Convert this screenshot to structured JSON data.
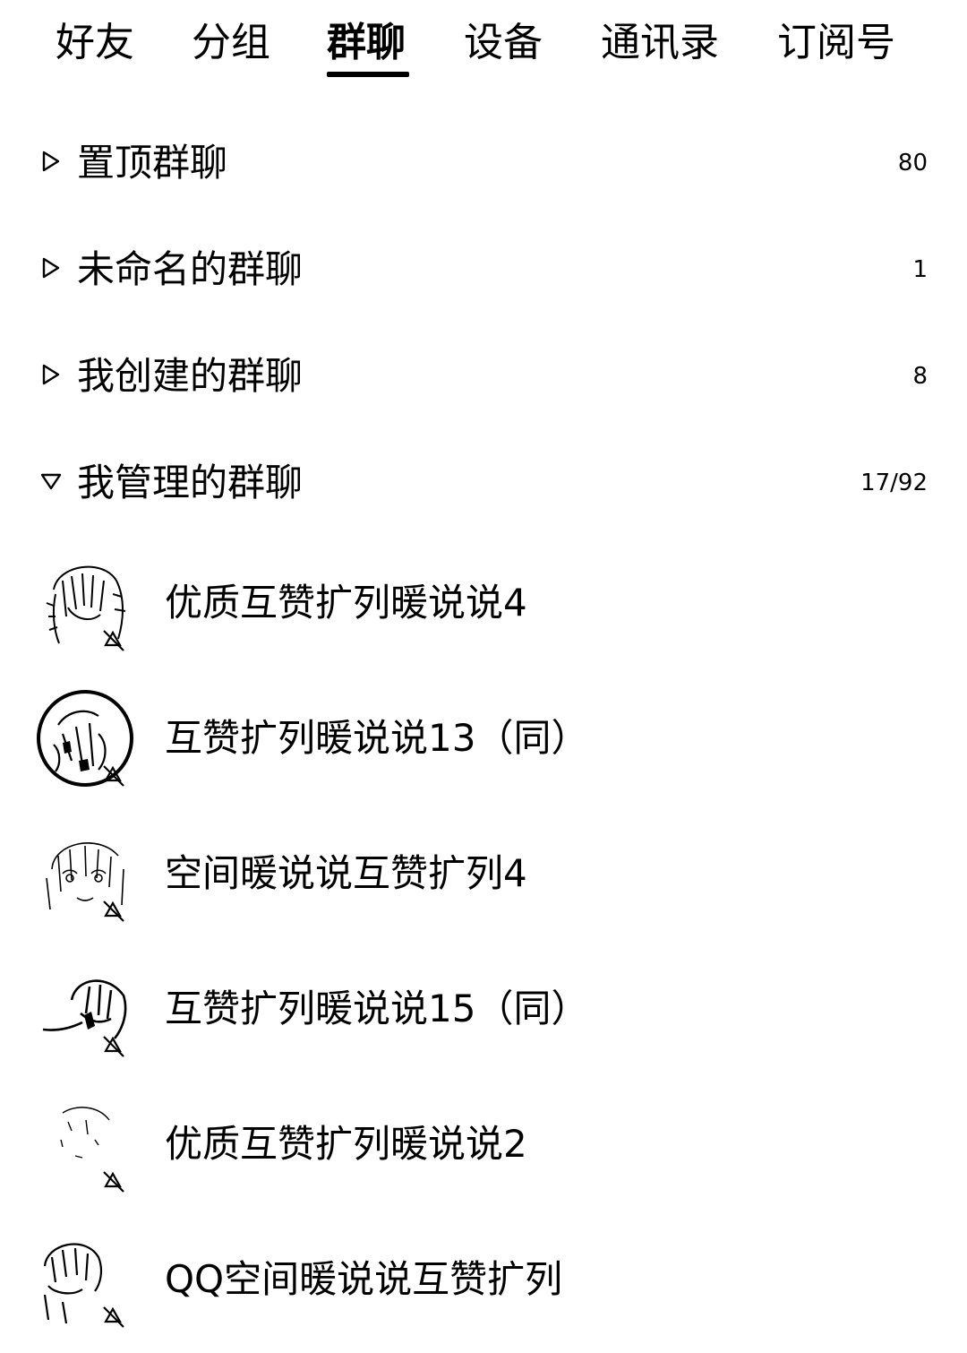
{
  "tabs": [
    {
      "label": "好友"
    },
    {
      "label": "分组"
    },
    {
      "label": "群聊"
    },
    {
      "label": "设备"
    },
    {
      "label": "通讯录"
    },
    {
      "label": "订阅号"
    }
  ],
  "active_tab": "群聊",
  "groups": [
    {
      "label": "置顶群聊",
      "count": "80",
      "expanded": false
    },
    {
      "label": "未命名的群聊",
      "count": "1",
      "expanded": false
    },
    {
      "label": "我创建的群聊",
      "count": "8",
      "expanded": false
    },
    {
      "label": "我管理的群聊",
      "count": "17/92",
      "expanded": true
    }
  ],
  "chats": [
    {
      "name": "优质互赞扩列暖说说4",
      "muted": true,
      "avatar": "avatar-sketch-girl-icon"
    },
    {
      "name": "互赞扩列暖说说13（同）",
      "muted": true,
      "avatar": "avatar-sketch-circle-icon"
    },
    {
      "name": "空间暖说说互赞扩列4",
      "muted": true,
      "avatar": "avatar-sketch-girl-icon"
    },
    {
      "name": "互赞扩列暖说说15（同）",
      "muted": true,
      "avatar": "avatar-sketch-boy-icon"
    },
    {
      "name": "优质互赞扩列暖说说2",
      "muted": true,
      "avatar": "avatar-sketch-faint-icon"
    },
    {
      "name": "QQ空间暖说说互赞扩列",
      "muted": true,
      "avatar": "avatar-sketch-boy-icon"
    }
  ],
  "colors": {
    "text": "#000000",
    "background": "#ffffff",
    "accent": "#000000"
  }
}
